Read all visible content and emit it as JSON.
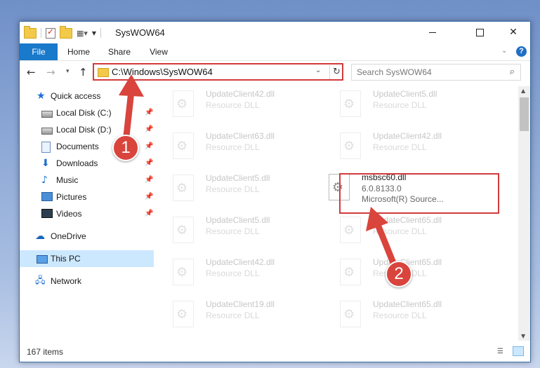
{
  "window": {
    "title": "SysWOW64"
  },
  "ribbon": {
    "tabs": [
      "File",
      "Home",
      "Share",
      "View"
    ]
  },
  "nav": {
    "address": "C:\\Windows\\SysWOW64",
    "search_placeholder": "Search SysWOW64"
  },
  "sidebar": {
    "quick_access": "Quick access",
    "items": [
      {
        "label": "Local Disk (C:)",
        "icon": "drive-icon"
      },
      {
        "label": "Local Disk (D:)",
        "icon": "drive-icon"
      },
      {
        "label": "Documents",
        "icon": "documents-icon"
      },
      {
        "label": "Downloads",
        "icon": "downloads-icon"
      },
      {
        "label": "Music",
        "icon": "music-icon"
      },
      {
        "label": "Pictures",
        "icon": "pictures-icon"
      },
      {
        "label": "Videos",
        "icon": "videos-icon"
      }
    ],
    "onedrive": "OneDrive",
    "thispc": "This PC",
    "network": "Network"
  },
  "files": [
    {
      "name": "UpdateClient42.dll",
      "type": "Resource DLL"
    },
    {
      "name": "UpdateClient5.dll",
      "type": "Resource DLL"
    },
    {
      "name": "UpdateClient63.dll",
      "type": "Resource DLL"
    },
    {
      "name": "UpdateClient42.dll",
      "type": "Resource DLL"
    },
    {
      "name": "UpdateClient5.dll",
      "type": "Resource DLL"
    },
    {
      "name": "msbsc60.dll",
      "version": "6.0.8133.0",
      "company": "Microsoft(R) Source..."
    },
    {
      "name": "UpdateClient5.dll",
      "type": "Resource DLL"
    },
    {
      "name": "UpdateClient65.dll",
      "type": "Resource DLL"
    },
    {
      "name": "UpdateClient42.dll",
      "type": "Resource DLL"
    },
    {
      "name": "UpdateClient65.dll",
      "type": "Resource DLL"
    },
    {
      "name": "UpdateClient19.dll",
      "type": "Resource DLL"
    },
    {
      "name": "UpdateClient65.dll",
      "type": "Resource DLL"
    }
  ],
  "status": {
    "count": "167 items"
  },
  "callouts": {
    "one": "1",
    "two": "2"
  },
  "colors": {
    "highlight": "#d23b3b",
    "accent": "#1979ca"
  }
}
